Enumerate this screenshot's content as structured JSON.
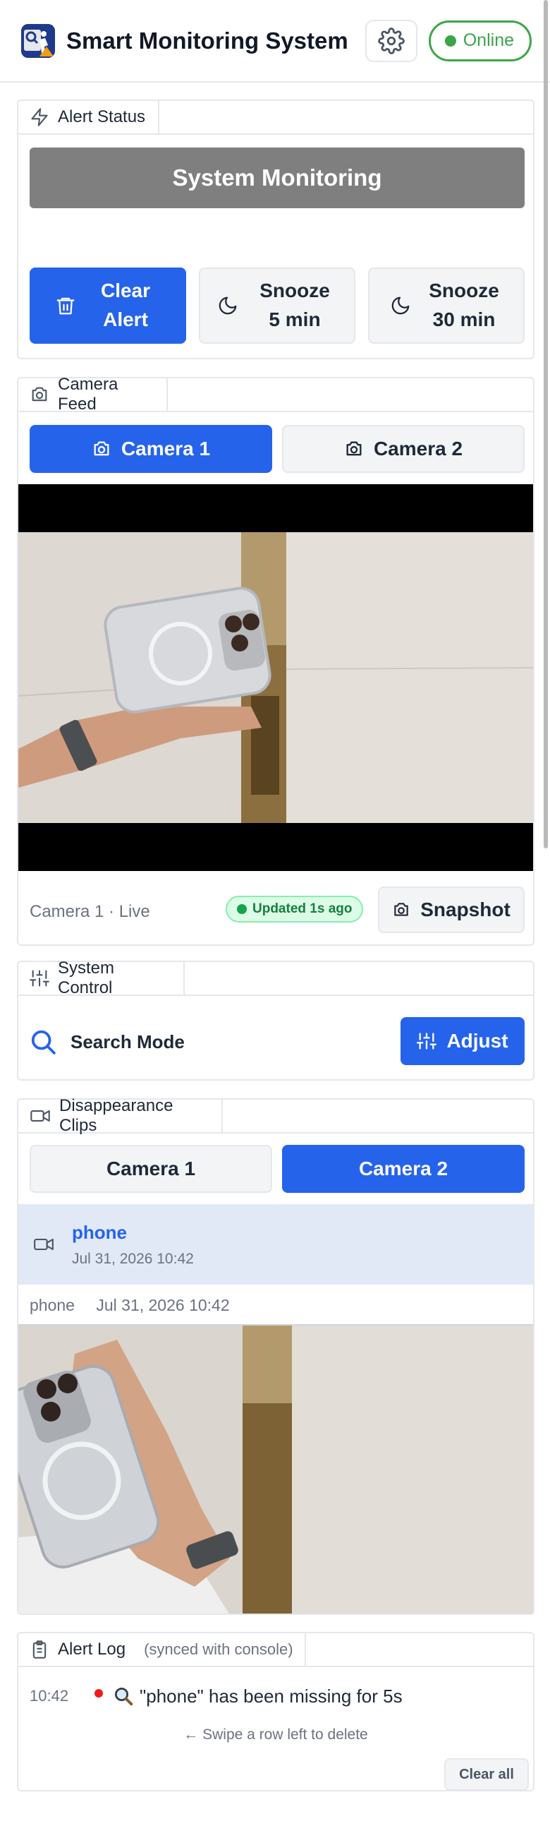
{
  "header": {
    "title": "Smart Monitoring System",
    "status": "Online",
    "accent": "#2563eb",
    "status_color": "#3ba54a"
  },
  "alert_status": {
    "tab_label": "Alert Status",
    "status_text": "System Monitoring",
    "buttons": [
      {
        "label": "Clear Alert",
        "icon": "trash-icon"
      },
      {
        "label": "Snooze 5 min",
        "icon": "moon-icon"
      },
      {
        "label": "Snooze 30 min",
        "icon": "moon-icon"
      }
    ]
  },
  "camera_feed": {
    "tab_label": "Camera Feed",
    "cameras": [
      "Camera 1",
      "Camera 2"
    ],
    "selected": "Camera 1",
    "footer_label": "Camera 1 · Live",
    "updated": "Updated 1s ago",
    "snapshot_label": "Snapshot"
  },
  "system_control": {
    "tab_label": "System Control",
    "mode_label": "Search Mode",
    "adjust_label": "Adjust"
  },
  "clips": {
    "tab_label": "Disappearance Clips",
    "cameras": [
      "Camera 1",
      "Camera 2"
    ],
    "selected": "Camera 2",
    "items": [
      {
        "name": "phone",
        "date": "Jul 31, 2026 10:42"
      }
    ],
    "player": {
      "name": "phone",
      "date": "Jul 31, 2026 10:42"
    }
  },
  "alert_log": {
    "tab_label": "Alert Log",
    "sub_label": "(synced with console)",
    "entries": [
      {
        "time": "10:42",
        "message": "\"phone\" has been missing for 5s",
        "icon": "magnifier-emoji-icon"
      }
    ],
    "hint": "← Swipe a row left to delete",
    "clear_all": "Clear all"
  }
}
